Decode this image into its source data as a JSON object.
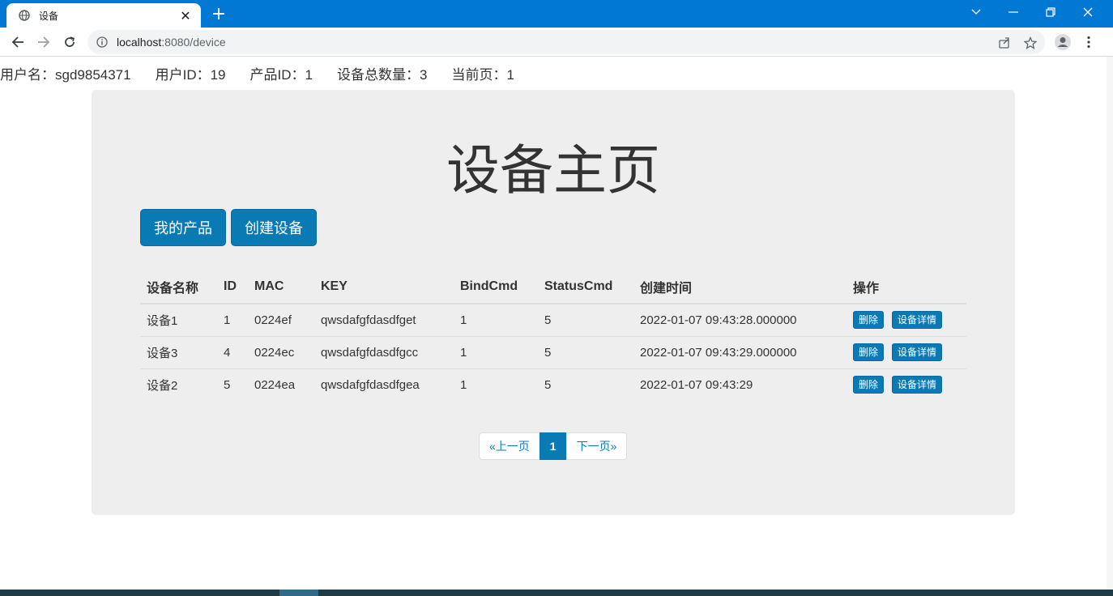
{
  "browser": {
    "tab_title": "设备",
    "tab_close": "✕",
    "new_tab": "+",
    "url_host": "localhost",
    "url_rest": ":8080/device"
  },
  "info": {
    "username": "用户名：sgd9854371",
    "user_id": "用户ID：19",
    "product_id": "产品ID：1",
    "device_total": "设备总数量：3",
    "current_page": "当前页：1"
  },
  "page": {
    "title": "设备主页",
    "my_products_button": "我的产品",
    "create_device_button": "创建设备"
  },
  "table": {
    "headers": [
      "设备名称",
      "ID",
      "MAC",
      "KEY",
      "BindCmd",
      "StatusCmd",
      "创建时间",
      "操作"
    ],
    "rows": [
      [
        "设备1",
        "1",
        "0224ef",
        "qwsdafgfdasdfget",
        "1",
        "5",
        "2022-01-07 09:43:28.000000"
      ],
      [
        "设备3",
        "4",
        "0224ec",
        "qwsdafgfdasdfgcc",
        "1",
        "5",
        "2022-01-07 09:43:29.000000"
      ],
      [
        "设备2",
        "5",
        "0224ea",
        "qwsdafgfdasdfgea",
        "1",
        "5",
        "2022-01-07 09:43:29"
      ]
    ],
    "delete_label": "删除",
    "detail_label": "设备详情"
  },
  "pagination": {
    "prev": "«上一页",
    "current": "1",
    "next": "下一页»"
  },
  "colors": {
    "accent": "#0a7ab5",
    "tabbar": "#0078d4",
    "jumbotron": "#eeeeee"
  }
}
